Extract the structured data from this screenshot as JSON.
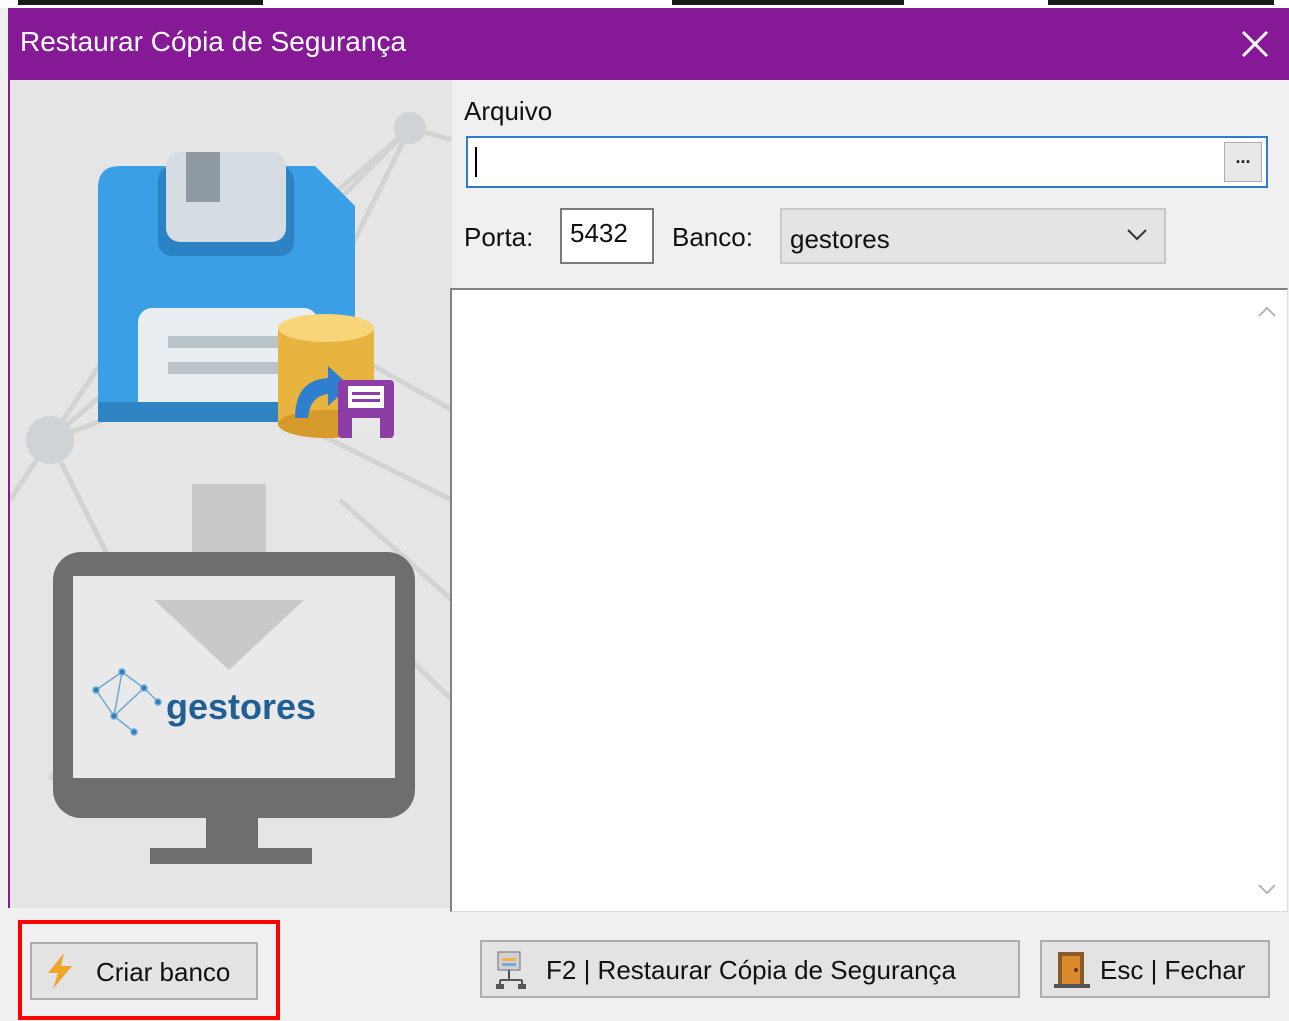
{
  "window": {
    "title": "Restaurar Cópia de Segurança",
    "title_bar_color": "#861a96",
    "close_icon": "close-icon"
  },
  "left_panel": {
    "brand_text": "gestores",
    "illustration": [
      "floppy-disk-icon",
      "database-restore-icon",
      "download-arrow-icon",
      "monitor-icon",
      "gestores-logo"
    ]
  },
  "form": {
    "arquivo_label": "Arquivo",
    "arquivo_value": "",
    "browse_label": "...",
    "porta_label": "Porta:",
    "porta_value": "5432",
    "banco_label": "Banco:",
    "banco_value": "gestores"
  },
  "buttons": {
    "criar_banco": "Criar banco",
    "restaurar": "F2 | Restaurar Cópia de Segurança",
    "fechar": "Esc | Fechar"
  },
  "accent_colors": {
    "highlight": "#ff0000",
    "focus_border": "#2e7bd6"
  }
}
